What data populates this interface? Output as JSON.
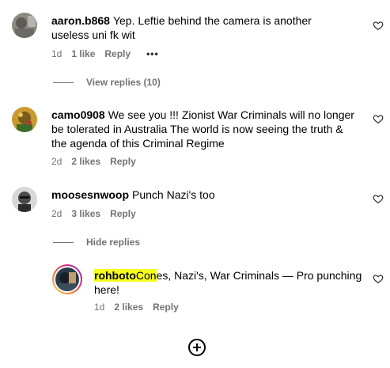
{
  "comments": [
    {
      "username": "aaron.b868",
      "text": "Yep. Leftie behind the camera is another useless uni fk wit",
      "time": "1d",
      "likes": "1 like",
      "reply": "Reply",
      "more": "•••",
      "view_replies": "View replies (10)"
    },
    {
      "username": "camo0908",
      "text": "We see you !!! Zionist War Criminals will no longer be tolerated in Australia The world is now seeing the truth & the agenda of this Criminal Regime",
      "time": "2d",
      "likes": "2 likes",
      "reply": "Reply"
    },
    {
      "username": "moosesnwoop",
      "text": "Punch Nazi's too",
      "time": "2d",
      "likes": "3 likes",
      "reply": "Reply",
      "hide_replies": "Hide replies"
    }
  ],
  "reply": {
    "username_prefix": "rohboto",
    "highlighted_text_part": "Con",
    "text_rest": "es, Nazi's, War Criminals — Pro punching here!",
    "time": "1d",
    "likes": "2 likes",
    "reply": "Reply"
  },
  "icons": {
    "heart": "heart-outline-icon",
    "load_more": "plus-circle-icon"
  },
  "colors": {
    "meta_text": "#737373",
    "highlight": "#f5ff1e",
    "story_ring_start": "#feda75",
    "story_ring_end": "#d62976"
  }
}
